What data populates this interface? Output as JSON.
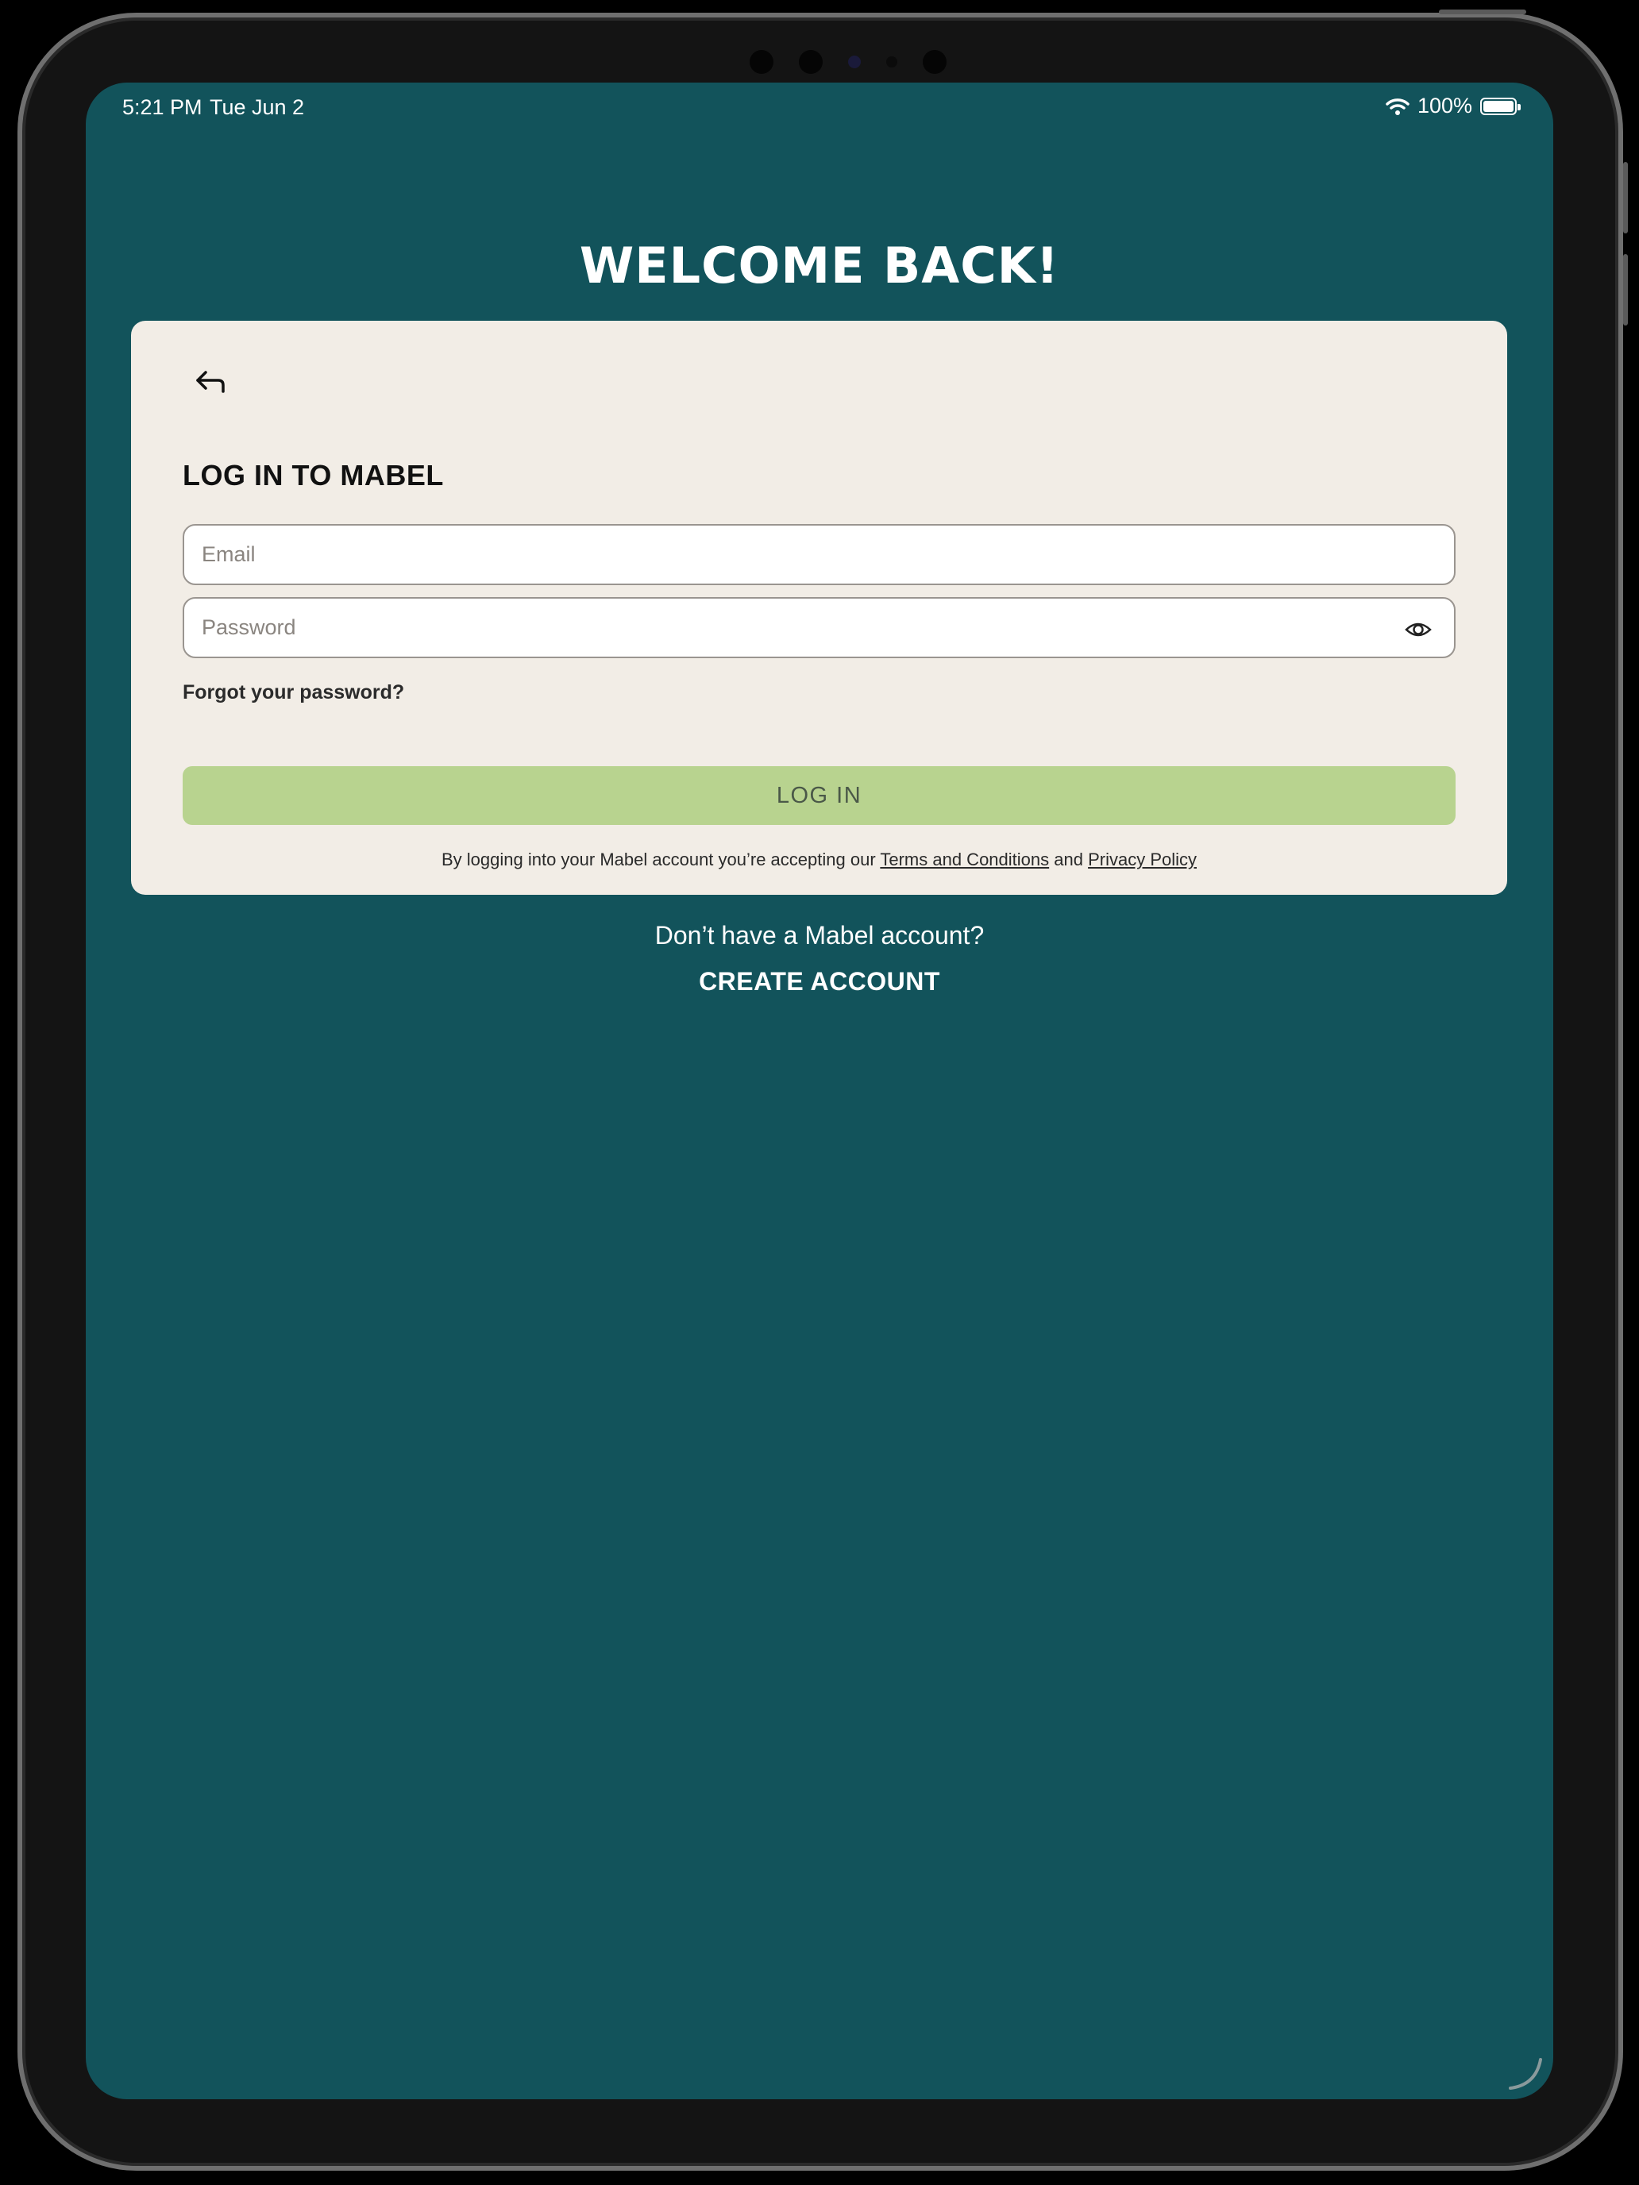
{
  "status_bar": {
    "time": "5:21 PM",
    "date": "Tue Jun 2",
    "battery_percent": "100%",
    "battery_level": 1.0,
    "icons": [
      "wifi-icon",
      "battery-icon"
    ]
  },
  "page": {
    "heading": "WELCOME BACK!"
  },
  "login_card": {
    "back_icon": "return-arrow-icon",
    "title": "LOG IN TO MABEL",
    "email": {
      "placeholder": "Email",
      "value": ""
    },
    "password": {
      "placeholder": "Password",
      "value": "",
      "toggle_icon": "eye-icon"
    },
    "forgot_password": "Forgot your password?",
    "login_button": "LOG IN",
    "legal": {
      "prefix": "By logging into your Mabel account you’re accepting our ",
      "terms_link": "Terms and Conditions",
      "middle": " and ",
      "privacy_link": "Privacy Policy"
    }
  },
  "signup": {
    "prompt": "Don’t have a Mabel account?",
    "create_account": "CREATE ACCOUNT"
  },
  "colors": {
    "background": "#12535b",
    "card": "#f2ede6",
    "login_button": "#b8d38f",
    "text_light": "#ffffff",
    "text_dark": "#111111"
  }
}
